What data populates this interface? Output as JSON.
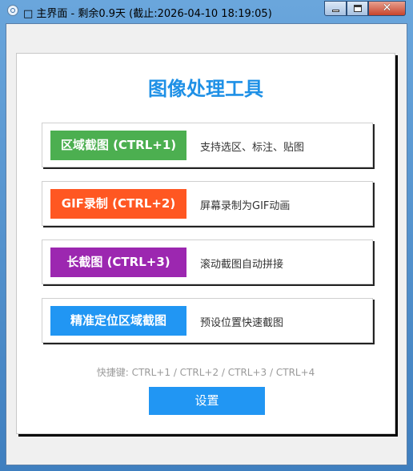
{
  "window": {
    "title": "□ 主界面 - 剩余0.9天 (截止:2026-04-10 18:19:05)",
    "controls": {
      "minimize_icon": "minimize-icon",
      "maximize_icon": "maximize-icon",
      "close_glyph": "✕"
    }
  },
  "main": {
    "heading": "图像处理工具",
    "rows": [
      {
        "label": "区域截图 (CTRL+1)",
        "desc": "支持选区、标注、贴图",
        "color": "#4caf50"
      },
      {
        "label": "GIF录制 (CTRL+2)",
        "desc": "屏幕录制为GIF动画",
        "color": "#ff5722"
      },
      {
        "label": "长截图 (CTRL+3)",
        "desc": "滚动截图自动拼接",
        "color": "#9c27b0"
      },
      {
        "label": "精准定位区域截图",
        "desc": "预设位置快速截图",
        "color": "#2196f3"
      }
    ],
    "shortcut_hint": "快捷键: CTRL+1 / CTRL+2 / CTRL+3 / CTRL+4",
    "settings_label": "设置"
  }
}
